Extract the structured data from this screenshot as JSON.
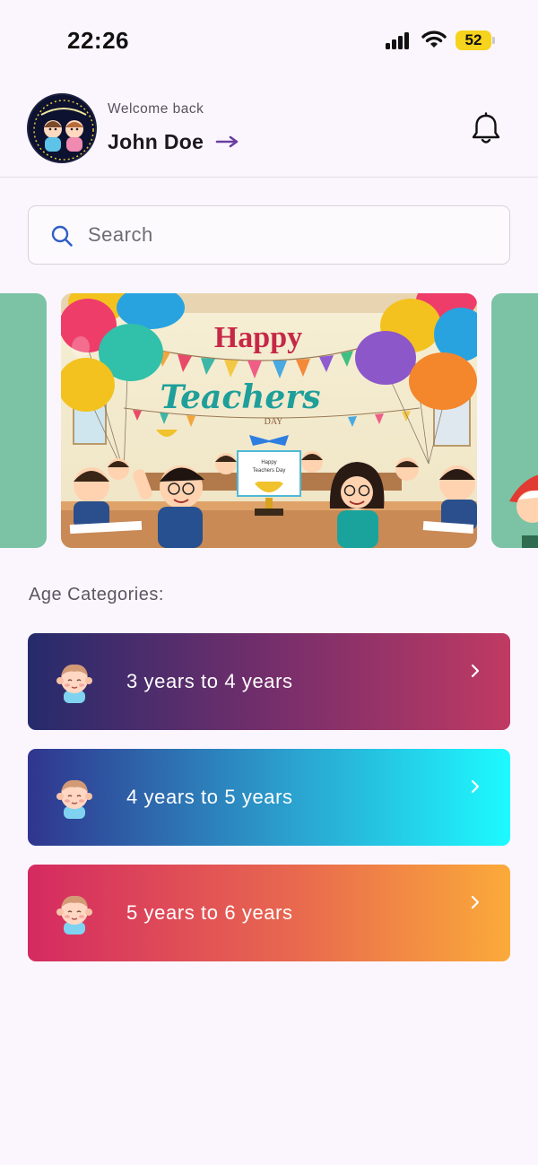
{
  "status_bar": {
    "time": "22:26",
    "battery": "52"
  },
  "header": {
    "welcome": "Welcome back",
    "user_name": "John Doe"
  },
  "search": {
    "placeholder": "Search"
  },
  "banner": {
    "title_line1": "Happy",
    "title_line2": "Teachers",
    "title_line3": "DAY",
    "card_line1": "Happy",
    "card_line2": "Teachers Day"
  },
  "age_section": {
    "title": "Age Categories:",
    "items": [
      {
        "label": "3 years to 4 years"
      },
      {
        "label": "4 years to 5 years"
      },
      {
        "label": "5 years to 6 years"
      }
    ]
  },
  "icons": {
    "signal": "signal-icon",
    "wifi": "wifi-icon",
    "bell": "bell-icon",
    "search": "search-icon",
    "arrow": "arrow-right-icon",
    "chevron": "chevron-right-icon",
    "kid": "kid-face-icon"
  },
  "colors": {
    "accent": "#6a3ea1",
    "background": "#fbf6fd"
  }
}
